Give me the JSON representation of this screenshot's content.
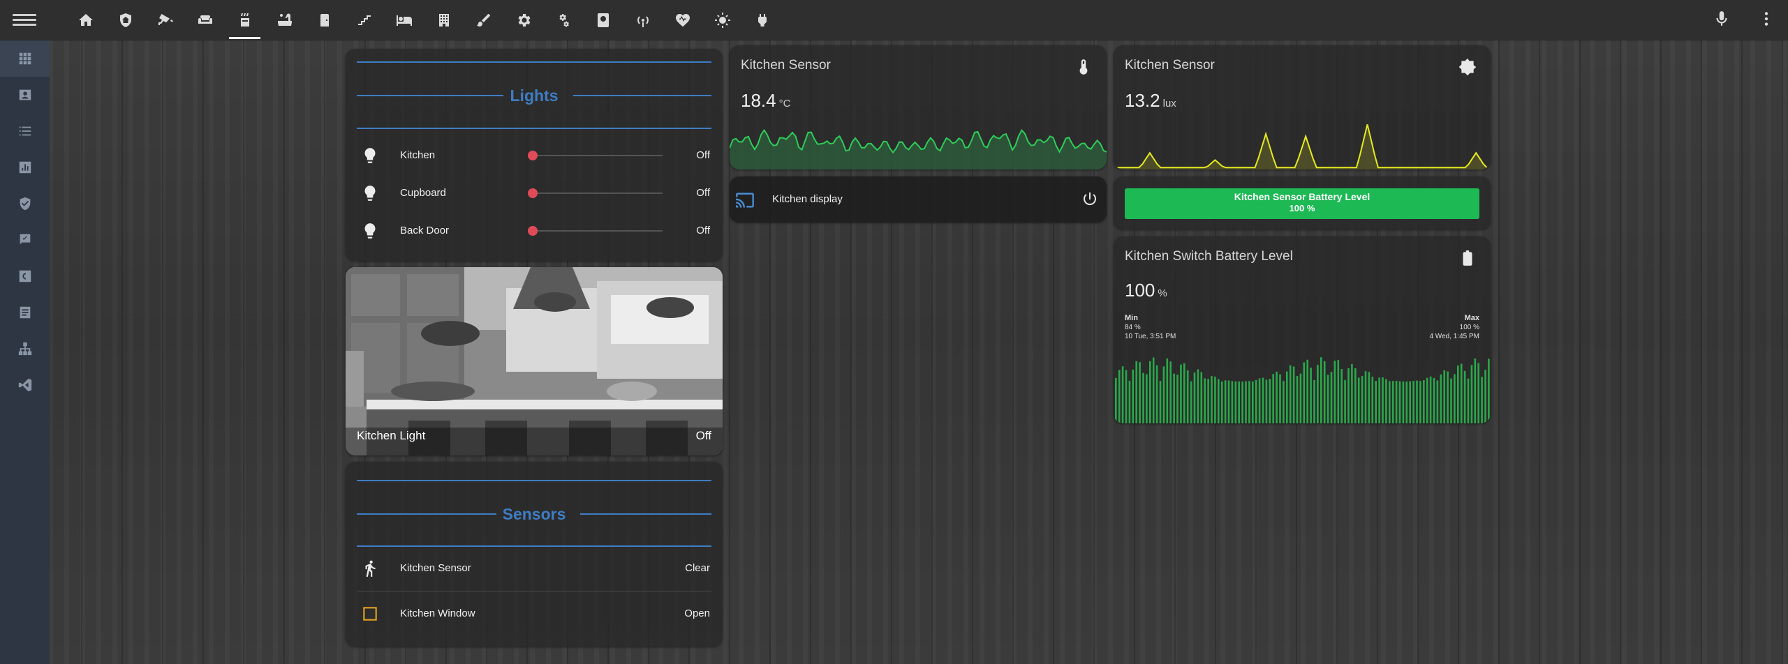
{
  "toolbar": {
    "tabs": [
      {
        "icon": "home-icon"
      },
      {
        "icon": "shield-home-icon"
      },
      {
        "icon": "cctv-icon"
      },
      {
        "icon": "sofa-icon"
      },
      {
        "icon": "stove-icon",
        "active": true
      },
      {
        "icon": "bathtub-icon"
      },
      {
        "icon": "door-icon"
      },
      {
        "icon": "stairs-icon"
      },
      {
        "icon": "bed-icon"
      },
      {
        "icon": "office-building-icon"
      },
      {
        "icon": "brush-icon"
      },
      {
        "icon": "cog-icon"
      },
      {
        "icon": "cogs-icon"
      },
      {
        "icon": "tablet-icon"
      },
      {
        "icon": "access-point-icon"
      },
      {
        "icon": "heart-pulse-icon"
      },
      {
        "icon": "sun-icon"
      },
      {
        "icon": "power-plug-icon"
      }
    ]
  },
  "lights_card": {
    "title": "Lights",
    "rows": [
      {
        "name": "Kitchen",
        "state": "Off"
      },
      {
        "name": "Cupboard",
        "state": "Off"
      },
      {
        "name": "Back Door",
        "state": "Off"
      }
    ]
  },
  "picture_card": {
    "name": "Kitchen Light",
    "state": "Off"
  },
  "sensors_card": {
    "title": "Sensors",
    "rows": [
      {
        "name": "Kitchen Sensor",
        "state": "Clear"
      },
      {
        "name": "Kitchen Window",
        "state": "Open"
      }
    ]
  },
  "temp_card": {
    "title": "Kitchen Sensor",
    "value": "18.4",
    "unit": "°C",
    "line_color": "#2fcc5a"
  },
  "lux_card": {
    "title": "Kitchen Sensor",
    "value": "13.2",
    "unit": "lux",
    "line_color": "#e6ea1e"
  },
  "display_card": {
    "name": "Kitchen display"
  },
  "battery_bar": {
    "label": "Kitchen Sensor Battery Level",
    "value_text": "100 %",
    "fraction": 1.0,
    "color": "#1db954"
  },
  "switch_battery": {
    "title": "Kitchen Switch Battery Level",
    "value": "100",
    "unit": "%",
    "min": {
      "label": "Min",
      "value": "84 %",
      "time": "10 Tue, 3:51 PM"
    },
    "max": {
      "label": "Max",
      "value": "100 %",
      "time": "4 Wed, 1:45 PM"
    },
    "bar_color": "#2aa84a"
  }
}
